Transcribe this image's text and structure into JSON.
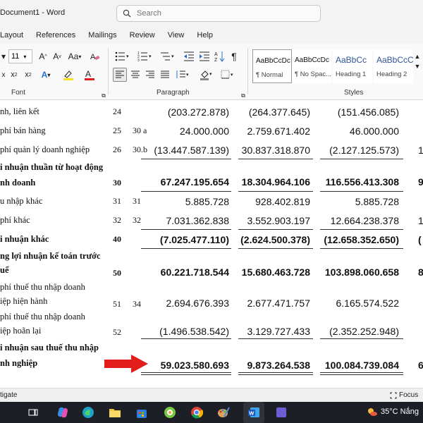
{
  "window": {
    "title": "Document1 - Word"
  },
  "search": {
    "placeholder": "Search"
  },
  "tabs": [
    "Layout",
    "References",
    "Mailings",
    "Review",
    "View",
    "Help"
  ],
  "ribbon": {
    "font_size": "11",
    "groups": {
      "font": "Font",
      "paragraph": "Paragraph",
      "styles": "Styles"
    },
    "styles": [
      {
        "preview": "AaBbCcDc",
        "name": "¶ Normal"
      },
      {
        "preview": "AaBbCcDc",
        "name": "¶ No Spac..."
      },
      {
        "preview": "AaBbCc",
        "name": "Heading 1"
      },
      {
        "preview": "AaBbCcC",
        "name": "Heading 2"
      }
    ]
  },
  "document": {
    "rows": [
      {
        "label": "nh, liên kết",
        "code": "24",
        "note": "",
        "v1": "(203.272.878)",
        "v2": "(264.377.645)",
        "v3": "(151.456.085)",
        "v4": ""
      },
      {
        "label": "phí bán hàng",
        "code": "25",
        "note": "30 a",
        "v1": "24.000.000",
        "v2": "2.759.671.402",
        "v3": "46.000.000",
        "v4": ""
      },
      {
        "label": "phí quản lý doanh nghiệp",
        "code": "26",
        "note": "30.b",
        "v1": "(13.447.587.139)",
        "v2": "30.837.318.870",
        "v3": "(2.127.125.573)",
        "v4": "1"
      },
      {
        "label": "i nhuận thuần từ hoạt động",
        "label2": "nh doanh",
        "code": "30",
        "note": "",
        "v1": "67.247.195.654",
        "v2": "18.304.964.106",
        "v3": "116.556.413.308",
        "v4": "9"
      },
      {
        "label": "u nhập khác",
        "code": "31",
        "note": "31",
        "v1": "5.885.728",
        "v2": "928.402.819",
        "v3": "5.885.728",
        "v4": ""
      },
      {
        "label": "phí khác",
        "code": "32",
        "note": "32",
        "v1": "7.031.362.838",
        "v2": "3.552.903.197",
        "v3": "12.664.238.378",
        "v4": "1"
      },
      {
        "label": "i nhuận khác",
        "code": "40",
        "note": "",
        "v1": "(7.025.477.110)",
        "v2": "(2.624.500.378)",
        "v3": "(12.658.352.650)",
        "v4": "("
      },
      {
        "label": "ng lợi nhuận kế toán trước",
        "label2": "uế",
        "code": "50",
        "note": "",
        "v1": "60.221.718.544",
        "v2": "15.680.463.728",
        "v3": "103.898.060.658",
        "v4": "8"
      },
      {
        "label": "phí thuế thu nhập doanh",
        "label2": "iệp hiện hành",
        "code": "51",
        "note": "34",
        "v1": "2.694.676.393",
        "v2": "2.677.471.757",
        "v3": "6.165.574.522",
        "v4": ""
      },
      {
        "label": "phí thuế thu nhập doanh",
        "label2": "iệp hoãn lại",
        "code": "52",
        "note": "",
        "v1": "(1.496.538.542)",
        "v2": "3.129.727.433",
        "v3": "(2.352.252.948)",
        "v4": ""
      },
      {
        "label": "i nhuận sau thuế thu nhập",
        "label2": "nh nghiệp",
        "code": "",
        "note": "",
        "v1": "59.023.580.693",
        "v2": "9.873.264.538",
        "v3": "100.084.739.084",
        "v4": "6"
      }
    ]
  },
  "statusbar": {
    "left": "tigate",
    "focus": "Focus"
  },
  "taskbar": {
    "weather": "35°C  Nắng"
  },
  "colors": {
    "arrow": "#e21b1b",
    "heading": "#2f5496",
    "taskbar": "#1c2026"
  }
}
